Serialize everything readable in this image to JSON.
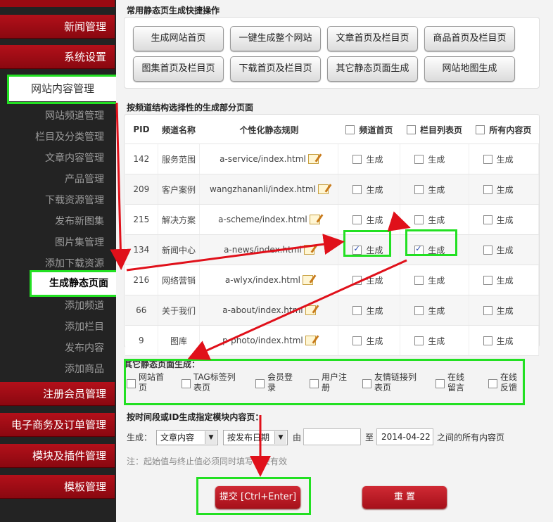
{
  "sidebar": {
    "sections": [
      {
        "label": "新闻管理"
      },
      {
        "label": "系统设置"
      },
      {
        "label": "网站内容管理"
      },
      {
        "label": "注册会员管理"
      },
      {
        "label": "电子商务及订单管理"
      },
      {
        "label": "模块及插件管理"
      },
      {
        "label": "模板管理"
      }
    ],
    "items": [
      {
        "label": "网站频道管理"
      },
      {
        "label": "栏目及分类管理"
      },
      {
        "label": "文章内容管理"
      },
      {
        "label": "产品管理"
      },
      {
        "label": "下载资源管理"
      },
      {
        "label": "发布新图集"
      },
      {
        "label": "图片集管理"
      },
      {
        "label": "添加下载资源"
      },
      {
        "label": "生成静态页面"
      },
      {
        "label": "添加频道"
      },
      {
        "label": "添加栏目"
      },
      {
        "label": "发布内容"
      },
      {
        "label": "添加商品"
      }
    ]
  },
  "quick": {
    "title": "常用静态页生成快捷操作",
    "buttons": [
      "生成网站首页",
      "一键生成整个网站",
      "文章首页及栏目页",
      "商品首页及栏目页",
      "图集首页及栏目页",
      "下载首页及栏目页",
      "其它静态页面生成",
      "网站地图生成"
    ]
  },
  "channels": {
    "title": "按频道结构选择性的生成部分页面",
    "headers": {
      "pid": "PID",
      "name": "频道名称",
      "rule": "个性化静态规则",
      "home": "频道首页",
      "list": "栏目列表页",
      "all": "所有内容页"
    },
    "gen_label": "生成",
    "rows": [
      {
        "pid": "142",
        "name": "服务范围",
        "rule": "a-service/index.html",
        "home": false,
        "list": false,
        "all": false
      },
      {
        "pid": "209",
        "name": "客户案例",
        "rule": "wangzhananli/index.html",
        "home": false,
        "list": false,
        "all": false
      },
      {
        "pid": "215",
        "name": "解决方案",
        "rule": "a-scheme/index.html",
        "home": false,
        "list": false,
        "all": false
      },
      {
        "pid": "134",
        "name": "新闻中心",
        "rule": "a-news/index.html",
        "home": true,
        "list": true,
        "all": false
      },
      {
        "pid": "216",
        "name": "网络营销",
        "rule": "a-wlyx/index.html",
        "home": false,
        "list": false,
        "all": false
      },
      {
        "pid": "66",
        "name": "关于我们",
        "rule": "a-about/index.html",
        "home": false,
        "list": false,
        "all": false
      },
      {
        "pid": "9",
        "name": "图库",
        "rule": "p-photo/index.html",
        "home": false,
        "list": false,
        "all": false
      }
    ]
  },
  "other": {
    "title": "其它静态页面生成：",
    "options": [
      {
        "l1": "网站首",
        "l2": "页"
      },
      {
        "l1": "TAG标签列",
        "l2": "表页"
      },
      {
        "l1": "会员登",
        "l2": "录"
      },
      {
        "l1": "用户注",
        "l2": "册"
      },
      {
        "l1": "友情链接列",
        "l2": "表页"
      },
      {
        "l1": "在线",
        "l2": "留言"
      },
      {
        "l1": "在线",
        "l2": "反馈"
      }
    ]
  },
  "bytime": {
    "title": "按时间段或ID生成指定模块内容页：",
    "gen_label": "生成：",
    "module": "文章内容",
    "order": "按发布日期",
    "from_label": "由",
    "to_label": "至",
    "from_value": "",
    "to_value": "2014-04-22",
    "suffix": "之间的所有内容页",
    "note": "注：起始值与终止值必须同时填写才会有效"
  },
  "actions": {
    "submit": "提交 [Ctrl+Enter]",
    "reset": "重 置"
  },
  "colors": {
    "accent": "#b3101a",
    "highlight": "#22e022",
    "arrow": "#e0101a"
  }
}
